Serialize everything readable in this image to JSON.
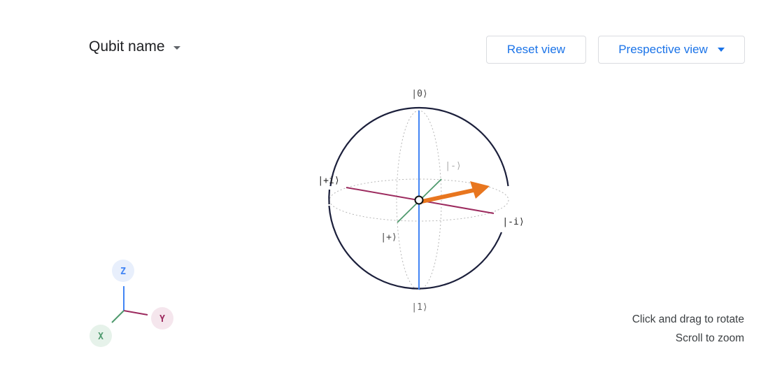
{
  "header": {
    "qubit_select_label": "Qubit name",
    "reset_button_label": "Reset view",
    "view_select_label": "Prespective view"
  },
  "sphere": {
    "labels": {
      "zero": "|0⟩",
      "one": "|1⟩",
      "plus_i": "|+i⟩",
      "minus_i": "|-i⟩",
      "plus": "|+⟩",
      "minus": "|-⟩"
    },
    "colors": {
      "z_axis": "#4285f4",
      "y_axis": "#9c2a5e",
      "x_axis": "#4f9a6e",
      "state_vector": "#e8761f",
      "sphere_outline": "#1b1f3b"
    }
  },
  "axis_gizmo": {
    "z": "Z",
    "y": "Y",
    "x": "X"
  },
  "hints": {
    "rotate": "Click and drag to rotate",
    "zoom": "Scroll to zoom"
  }
}
